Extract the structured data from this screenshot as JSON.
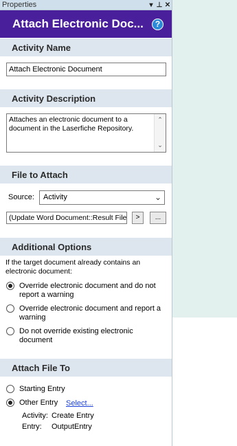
{
  "window": {
    "title": "Properties",
    "controls": [
      "▾",
      "⊥",
      "✕"
    ]
  },
  "header": {
    "title": "Attach Electronic Doc...",
    "help": "?"
  },
  "activity_name": {
    "heading": "Activity Name",
    "value": "Attach Electronic Document"
  },
  "activity_description": {
    "heading": "Activity Description",
    "value": "Attaches an electronic document to a document in the Laserfiche Repository."
  },
  "file_to_attach": {
    "heading": "File to Attach",
    "source_label": "Source:",
    "source_value": "Activity",
    "path_value": "(Update Word Document::Result File",
    "arrow_button": ">",
    "browse_button": "..."
  },
  "additional_options": {
    "heading": "Additional Options",
    "intro": "If the target document already contains an electronic document:",
    "options": [
      {
        "label": "Override electronic document and do not report a warning",
        "selected": true
      },
      {
        "label": "Override electronic document and report a warning",
        "selected": false
      },
      {
        "label": "Do not override existing electronic document",
        "selected": false
      }
    ]
  },
  "attach_file_to": {
    "heading": "Attach File To",
    "options": [
      {
        "label": "Starting Entry",
        "selected": false
      },
      {
        "label": "Other Entry",
        "selected": true
      }
    ],
    "select_link": "Select...",
    "activity_label": "Activity:",
    "activity_value": "Create Entry",
    "entry_label": "Entry:",
    "entry_value": "OutputEntry"
  }
}
